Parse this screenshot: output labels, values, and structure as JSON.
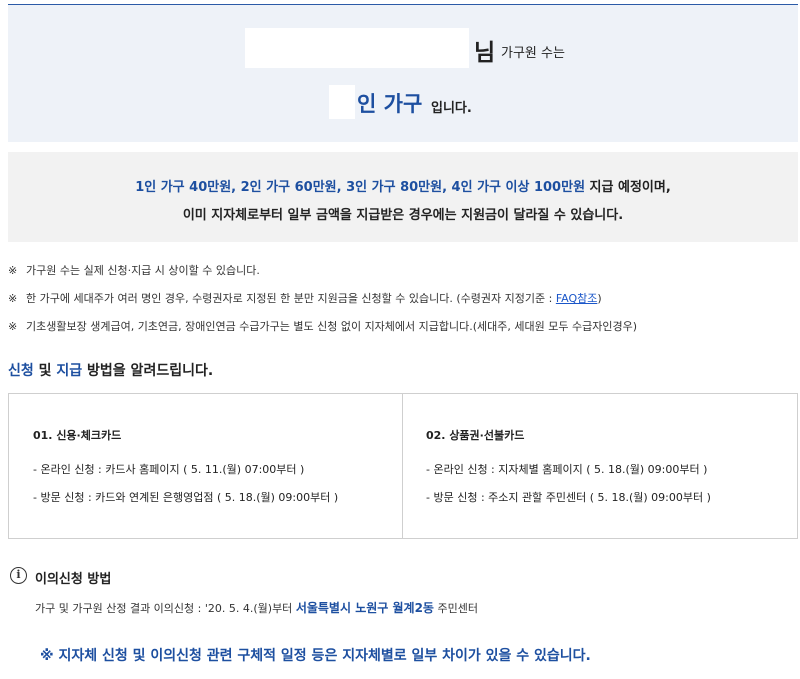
{
  "household": {
    "name_suffix": "님",
    "line1_text": " 가구원 수는",
    "count_unit": "인 가구",
    "line2_tail": "입니다."
  },
  "notice": {
    "line1_blue_1": "1인 가구 40만원, 2인 가구 60만원, 3인 가구 80만원, 4인 가구 이상 100만원",
    "line1_tail": " 지급 예정이며,",
    "line2": "이미 지자체로부터 일부 금액을 지급받은 경우에는 지원금이 달라질 수 있습니다."
  },
  "remarks": {
    "mark": "※",
    "items": [
      "가구원 수는 실제 신청·지급 시 상이할 수 있습니다.",
      "한 가구에 세대주가 여러 명인 경우, 수령권자로 지정된 한 분만 지원금을 신청할 수 있습니다. (수령권자 지정기준 : ",
      "기초생활보장 생계급여, 기초연금, 장애인연금 수급가구는 별도 신청 없이 지자체에서 지급합니다.(세대주, 세대원 모두 수급자인경우)"
    ],
    "faq_link": "FAQ참조",
    "faq_close": ")"
  },
  "method": {
    "title_blue_1": "신청",
    "title_mid": " 및 ",
    "title_blue_2": "지급",
    "title_tail": " 방법을 알려드립니다.",
    "columns": [
      {
        "title": "01. 신용·체크카드",
        "online": "- 온라인 신청 : 카드사 홈페이지 ( 5. 11.(월) 07:00부터 )",
        "visit": "- 방문 신청 : 카드와 연계된 은행영업점 ( 5. 18.(월) 09:00부터 )"
      },
      {
        "title": "02. 상품권·선불카드",
        "online": "- 온라인 신청 : 지자체별 홈페이지 ( 5. 18.(월) 09:00부터 )",
        "visit": "- 방문 신청 : 주소지 관할 주민센터 ( 5. 18.(월) 09:00부터 )"
      }
    ]
  },
  "objection": {
    "icon": "i",
    "title": "이의신청 방법",
    "desc_head": "가구 및 가구원 산정 결과 이의신청 : '20. 5. 4.(월)부터 ",
    "desc_blue": "서울특별시 노원구 월계2동",
    "desc_tail": " 주민센터"
  },
  "footer_note": "※ 지자체 신청 및 이의신청 관련 구체적 일정 등은 지자체별로 일부 차이가 있을 수 있습니다.",
  "colors": {
    "accent": "#1d4fa0",
    "link": "#1a56c9",
    "household_bg": "#eef2f8",
    "notice_bg": "#f2f2f2"
  }
}
